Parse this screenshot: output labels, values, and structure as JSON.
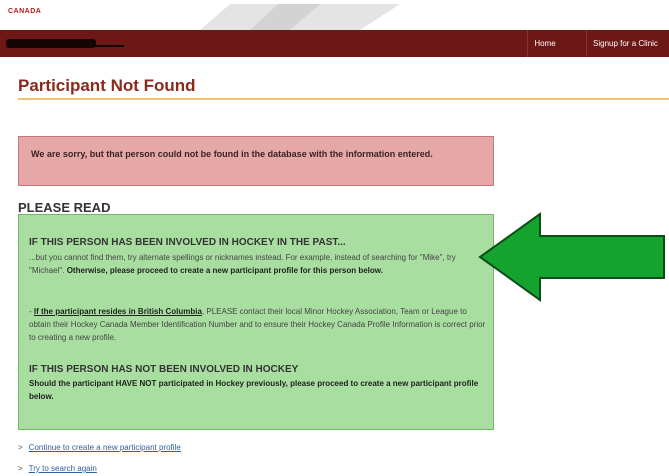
{
  "header": {
    "brand": "CANADA",
    "nav": [
      "Home",
      "Signup for a Clinic"
    ]
  },
  "page": {
    "title": "Participant Not Found"
  },
  "alert": {
    "text": "We are sorry, but that person could not be found in the database with the information entered."
  },
  "please_read": {
    "heading": "PLEASE READ",
    "section1": {
      "title": "IF THIS PERSON HAS BEEN INVOLVED IN HOCKEY IN THE PAST...",
      "text_a": "...but you cannot find them, try alternate spellings or nicknames instead. For example, instead of searching for \"Mike\", try \"Michael\". ",
      "text_bold": "Otherwise, please proceed to create a new participant profile for this person below."
    },
    "section2": {
      "prefix": "- ",
      "link": "If the participant resides in British Columbia",
      "text": ", PLEASE contact their local Minor Hockey Association, Team or League to obtain their Hockey Canada Member Identification Number and to ensure their Hockey Canada Profile Information is correct prior to creating a new profile."
    },
    "section3": {
      "title": "IF THIS PERSON HAS NOT BEEN INVOLVED IN HOCKEY",
      "text": "Should the participant HAVE NOT participated in Hockey previously, please proceed to create a new participant profile below."
    }
  },
  "links": [
    {
      "bullet": ">",
      "text": "Continue to create a new participant profile"
    },
    {
      "bullet": ">",
      "text": "Try to search again"
    }
  ],
  "colors": {
    "navbar": "#6e1717",
    "title": "#8a2a1c",
    "alert_bg": "#e6a7a7",
    "info_bg": "#a9dea1",
    "arrow": "#15a330"
  }
}
